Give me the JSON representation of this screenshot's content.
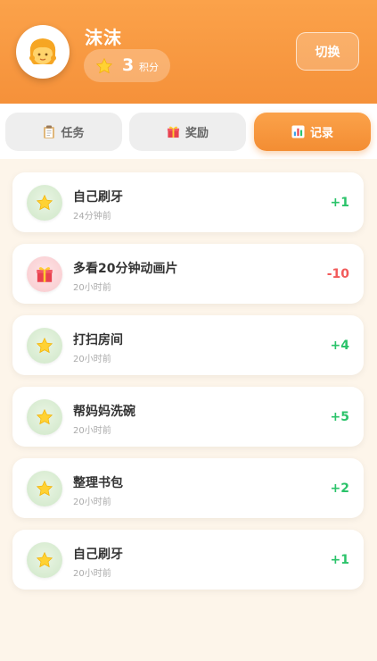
{
  "header": {
    "username": "沫沫",
    "points_value": "3",
    "points_unit": "积分",
    "switch_label": "切换",
    "avatar_icon": "child-face-icon",
    "points_icon": "star-icon"
  },
  "tabs": [
    {
      "label": "任务",
      "icon": "clipboard-icon",
      "active": false
    },
    {
      "label": "奖励",
      "icon": "gift-icon",
      "active": false
    },
    {
      "label": "记录",
      "icon": "bar-chart-icon",
      "active": true
    }
  ],
  "records": [
    {
      "title": "自己刷牙",
      "time": "24分钟前",
      "delta": "+1",
      "icon": "star-icon",
      "kind": "earn"
    },
    {
      "title": "多看20分钟动画片",
      "time": "20小时前",
      "delta": "-10",
      "icon": "gift-icon",
      "kind": "spend"
    },
    {
      "title": "打扫房间",
      "time": "20小时前",
      "delta": "+4",
      "icon": "star-icon",
      "kind": "earn"
    },
    {
      "title": "帮妈妈洗碗",
      "time": "20小时前",
      "delta": "+5",
      "icon": "star-icon",
      "kind": "earn"
    },
    {
      "title": "整理书包",
      "time": "20小时前",
      "delta": "+2",
      "icon": "star-icon",
      "kind": "earn"
    },
    {
      "title": "自己刷牙",
      "time": "20小时前",
      "delta": "+1",
      "icon": "star-icon",
      "kind": "earn"
    }
  ],
  "colors": {
    "accent": "#f5913a",
    "positive": "#2bc36a",
    "negative": "#f25a5a",
    "background": "#fdf5ea"
  }
}
